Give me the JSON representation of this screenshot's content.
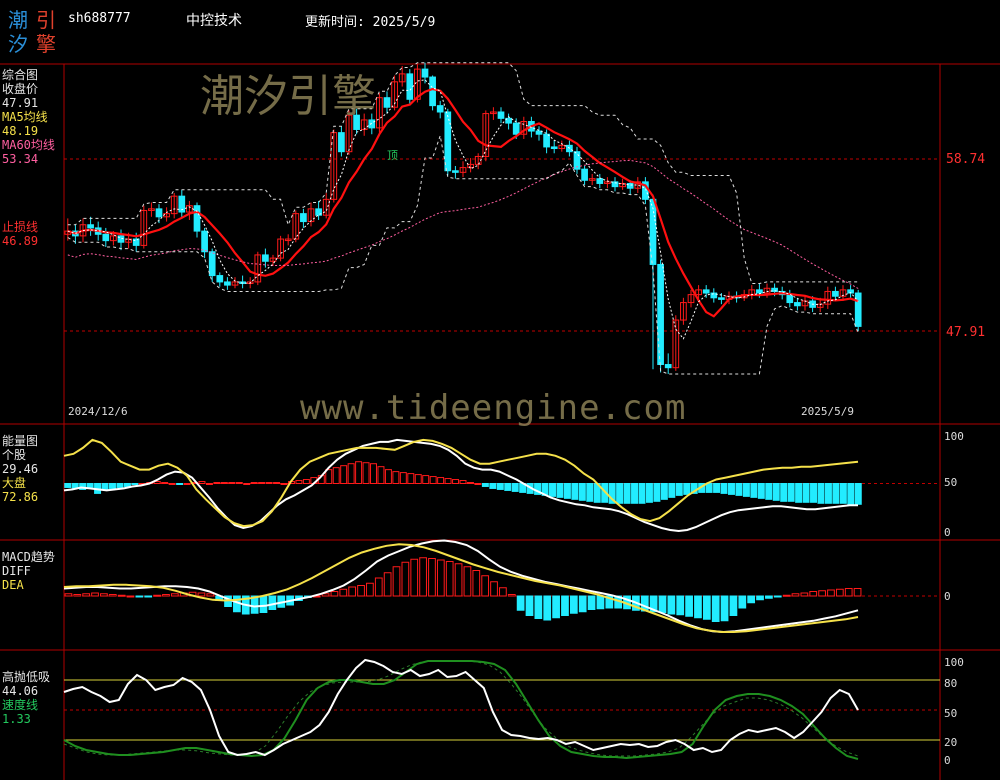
{
  "header": {
    "logo_chars": [
      "潮",
      "引",
      "汐",
      "擎"
    ],
    "symbol": "sh688777",
    "name": "中控技术",
    "update_label": "更新时间: 2025/5/9"
  },
  "watermarks": {
    "cn": "潮汐引擎",
    "url": "www.tideengine.com"
  },
  "colors": {
    "up": "#ff1a1a",
    "down": "#22ecff",
    "ma5": "#f5e14a",
    "ma60": "#ff5fa0",
    "stoploss": "#ff2a2a",
    "grid": "#b00000"
  },
  "panel_main": {
    "title": "综合图",
    "close_label": "收盘价",
    "close_value": "47.91",
    "ma5_label": "MA5均线",
    "ma5_value": "48.19",
    "ma60_label": "MA60均线",
    "ma60_value": "53.34",
    "stop_label": "止损线",
    "stop_value": "46.89",
    "price_levels": [
      "58.74",
      "47.91"
    ],
    "start_date": "2024/12/6",
    "end_date": "2025/5/9",
    "marker_text": "顶",
    "candles": [
      [
        54.0,
        54.2,
        55.0,
        53.6
      ],
      [
        54.2,
        53.9,
        54.6,
        53.4
      ],
      [
        53.9,
        54.6,
        55.0,
        53.5
      ],
      [
        54.6,
        54.4,
        55.1,
        53.9
      ],
      [
        54.4,
        54.0,
        54.8,
        53.6
      ],
      [
        54.0,
        53.6,
        54.4,
        53.2
      ],
      [
        53.6,
        53.9,
        54.2,
        53.3
      ],
      [
        53.9,
        53.5,
        54.3,
        53.0
      ],
      [
        53.5,
        53.7,
        54.1,
        53.1
      ],
      [
        53.7,
        53.3,
        54.1,
        52.9
      ],
      [
        53.3,
        55.5,
        55.8,
        53.1
      ],
      [
        55.5,
        55.6,
        56.0,
        55.1
      ],
      [
        55.6,
        55.1,
        55.9,
        54.7
      ],
      [
        55.1,
        55.3,
        55.7,
        54.8
      ],
      [
        55.3,
        56.4,
        56.6,
        55.0
      ],
      [
        56.4,
        55.4,
        56.8,
        55.0
      ],
      [
        55.4,
        55.8,
        56.1,
        54.9
      ],
      [
        55.8,
        54.2,
        56.0,
        53.8
      ],
      [
        54.2,
        52.9,
        54.4,
        52.5
      ],
      [
        52.9,
        51.4,
        53.1,
        51.0
      ],
      [
        51.4,
        51.0,
        51.6,
        50.7
      ],
      [
        51.0,
        50.8,
        51.3,
        50.5
      ],
      [
        50.8,
        51.0,
        51.3,
        50.6
      ],
      [
        51.0,
        50.9,
        51.4,
        50.6
      ],
      [
        50.9,
        51.0,
        51.3,
        50.6
      ],
      [
        51.0,
        52.7,
        52.9,
        50.8
      ],
      [
        52.7,
        52.3,
        53.1,
        51.9
      ],
      [
        52.3,
        52.5,
        52.7,
        52.0
      ],
      [
        52.5,
        53.7,
        53.9,
        52.3
      ],
      [
        53.7,
        53.7,
        54.0,
        53.3
      ],
      [
        53.7,
        55.3,
        55.5,
        53.5
      ],
      [
        55.3,
        54.8,
        55.6,
        54.4
      ],
      [
        54.8,
        55.6,
        56.0,
        54.5
      ],
      [
        55.6,
        55.2,
        56.1,
        54.9
      ],
      [
        55.2,
        56.2,
        56.6,
        55.0
      ],
      [
        56.2,
        60.4,
        60.6,
        56.0
      ],
      [
        60.4,
        59.2,
        60.8,
        58.9
      ],
      [
        59.2,
        61.5,
        61.8,
        59.0
      ],
      [
        61.5,
        60.6,
        61.9,
        60.3
      ],
      [
        60.6,
        61.2,
        61.6,
        60.2
      ],
      [
        61.2,
        60.7,
        61.6,
        60.3
      ],
      [
        60.7,
        62.6,
        62.9,
        60.4
      ],
      [
        62.6,
        62.0,
        63.0,
        61.6
      ],
      [
        62.0,
        63.6,
        64.0,
        61.8
      ],
      [
        63.6,
        64.1,
        64.6,
        63.3
      ],
      [
        64.1,
        62.5,
        64.4,
        62.2
      ],
      [
        62.5,
        64.4,
        64.7,
        62.3
      ],
      [
        64.4,
        63.9,
        64.8,
        63.5
      ],
      [
        63.9,
        62.1,
        64.0,
        61.8
      ],
      [
        62.1,
        61.7,
        62.4,
        61.3
      ],
      [
        61.7,
        58.0,
        61.9,
        57.7
      ],
      [
        58.0,
        57.9,
        58.3,
        57.5
      ],
      [
        57.9,
        58.2,
        58.6,
        57.6
      ],
      [
        58.2,
        58.4,
        58.8,
        57.9
      ],
      [
        58.4,
        58.9,
        59.1,
        58.1
      ],
      [
        58.9,
        61.6,
        61.8,
        58.6
      ],
      [
        61.6,
        61.7,
        62.0,
        61.2
      ],
      [
        61.7,
        61.3,
        62.0,
        61.0
      ],
      [
        61.3,
        61.0,
        61.6,
        60.6
      ],
      [
        61.0,
        60.3,
        61.3,
        60.0
      ],
      [
        60.3,
        61.1,
        61.4,
        60.0
      ],
      [
        61.1,
        60.5,
        61.4,
        60.1
      ],
      [
        60.5,
        60.3,
        60.8,
        59.9
      ],
      [
        60.3,
        59.5,
        60.6,
        59.1
      ],
      [
        59.5,
        59.4,
        59.9,
        59.1
      ],
      [
        59.4,
        59.6,
        59.9,
        59.2
      ],
      [
        59.6,
        59.2,
        59.9,
        58.9
      ],
      [
        59.2,
        58.1,
        59.5,
        57.8
      ],
      [
        58.1,
        57.4,
        58.3,
        57.1
      ],
      [
        57.4,
        57.5,
        57.8,
        57.1
      ],
      [
        57.5,
        57.2,
        57.8,
        56.9
      ],
      [
        57.2,
        57.3,
        57.6,
        56.9
      ],
      [
        57.3,
        57.0,
        57.6,
        56.7
      ],
      [
        57.0,
        57.2,
        57.5,
        56.8
      ],
      [
        57.2,
        56.9,
        57.4,
        56.5
      ],
      [
        56.9,
        57.3,
        57.6,
        56.6
      ],
      [
        57.3,
        56.2,
        57.6,
        55.9
      ],
      [
        56.2,
        52.1,
        56.5,
        45.5
      ],
      [
        52.1,
        45.8,
        52.4,
        45.3
      ],
      [
        45.8,
        45.6,
        46.5,
        45.2
      ],
      [
        45.6,
        48.6,
        48.9,
        45.4
      ],
      [
        48.6,
        49.7,
        50.0,
        48.3
      ],
      [
        49.7,
        50.2,
        50.5,
        49.4
      ],
      [
        50.2,
        50.5,
        50.8,
        49.9
      ],
      [
        50.5,
        50.3,
        50.8,
        50.0
      ],
      [
        50.3,
        50.0,
        50.6,
        49.7
      ],
      [
        50.0,
        49.9,
        50.3,
        49.6
      ],
      [
        49.9,
        50.1,
        50.4,
        49.6
      ],
      [
        50.1,
        50.0,
        50.4,
        49.7
      ],
      [
        50.0,
        50.2,
        50.5,
        49.8
      ],
      [
        50.2,
        50.5,
        50.8,
        49.9
      ],
      [
        50.5,
        50.3,
        50.9,
        50.0
      ],
      [
        50.3,
        50.6,
        50.9,
        50.0
      ],
      [
        50.6,
        50.4,
        50.9,
        50.1
      ],
      [
        50.4,
        50.2,
        50.7,
        49.9
      ],
      [
        50.2,
        49.7,
        50.5,
        49.4
      ],
      [
        49.7,
        49.5,
        50.0,
        49.2
      ],
      [
        49.5,
        49.8,
        50.1,
        49.2
      ],
      [
        49.8,
        49.4,
        50.1,
        49.1
      ],
      [
        49.4,
        49.6,
        50.0,
        49.1
      ],
      [
        49.6,
        50.4,
        50.7,
        49.3
      ],
      [
        50.4,
        50.1,
        50.7,
        49.8
      ],
      [
        50.1,
        50.5,
        50.8,
        49.8
      ],
      [
        50.5,
        50.3,
        50.8,
        50.0
      ],
      [
        50.3,
        48.2,
        50.5,
        47.9
      ]
    ]
  },
  "panel_energy": {
    "title": "能量图",
    "stock_label": "个股",
    "stock_value": "29.46",
    "market_label": "大盘",
    "market_value": "72.86",
    "scale": [
      "100",
      "50",
      "0"
    ],
    "bars": [
      -4,
      -5,
      -6,
      -4,
      -10,
      -6,
      -5,
      -4,
      -3,
      -1,
      0,
      1,
      2,
      1,
      0,
      -1,
      0,
      1,
      2,
      0,
      1,
      1,
      1,
      1,
      0,
      1,
      1,
      1,
      1,
      0,
      2,
      3,
      4,
      6,
      8,
      14,
      16,
      18,
      20,
      22,
      21,
      20,
      17,
      14,
      12,
      11,
      10,
      9,
      8,
      7,
      6,
      5,
      4,
      3,
      1,
      0,
      -3,
      -5,
      -6,
      -7,
      -8,
      -9,
      -10,
      -11,
      -12,
      -13,
      -14,
      -15,
      -16,
      -17,
      -18,
      -19,
      -19,
      -20,
      -20,
      -20,
      -20,
      -20,
      -19,
      -18,
      -16,
      -14,
      -12,
      -11,
      -10,
      -9,
      -9,
      -9,
      -10,
      -11,
      -12,
      -13,
      -14,
      -15,
      -16,
      -17,
      -18,
      -18,
      -19,
      -19,
      -19,
      -20,
      -20,
      -20,
      -20,
      -21,
      -21
    ],
    "stock_line": [
      43,
      44,
      46,
      45,
      44,
      43,
      44,
      45,
      47,
      48,
      50,
      54,
      59,
      62,
      61,
      56,
      46,
      36,
      25,
      16,
      8,
      5,
      7,
      12,
      20,
      28,
      34,
      38,
      43,
      48,
      56,
      66,
      74,
      80,
      84,
      88,
      90,
      92,
      92,
      94,
      93,
      92,
      91,
      90,
      88,
      84,
      78,
      70,
      66,
      64,
      64,
      62,
      58,
      54,
      49,
      44,
      40,
      36,
      33,
      31,
      29,
      28,
      26,
      25,
      24,
      22,
      19,
      15,
      11,
      8,
      5,
      3,
      2,
      3,
      6,
      10,
      14,
      18,
      21,
      23,
      24,
      25,
      26,
      27,
      27,
      26,
      25,
      24,
      24,
      25,
      26,
      27,
      28,
      28
    ],
    "market_line": [
      78,
      80,
      86,
      94,
      91,
      82,
      72,
      68,
      64,
      64,
      68,
      70,
      66,
      58,
      44,
      34,
      25,
      16,
      10,
      7,
      8,
      12,
      22,
      36,
      52,
      64,
      72,
      76,
      80,
      82,
      84,
      86,
      86,
      86,
      85,
      84,
      88,
      92,
      94,
      93,
      90,
      86,
      80,
      74,
      70,
      70,
      72,
      74,
      76,
      78,
      80,
      80,
      78,
      74,
      68,
      60,
      54,
      44,
      34,
      26,
      19,
      14,
      12,
      15,
      22,
      30,
      38,
      44,
      50,
      54,
      56,
      58,
      60,
      62,
      64,
      65,
      66,
      66,
      67,
      67,
      68,
      69,
      70,
      71,
      72
    ]
  },
  "panel_macd": {
    "title": "MACD趋势",
    "diff_label": "DIFF",
    "dea_label": "DEA",
    "scale": [
      "0"
    ],
    "bars": [
      0.3,
      0.2,
      0.3,
      0.4,
      0.3,
      0.2,
      0.1,
      0.0,
      -0.1,
      -0.1,
      0.1,
      0.2,
      0.3,
      0.4,
      0.5,
      0.4,
      0.3,
      -0.6,
      -1.4,
      -2.1,
      -2.4,
      -2.3,
      -2.2,
      -1.8,
      -1.5,
      -1.2,
      -0.6,
      -0.2,
      0.0,
      0.3,
      0.6,
      0.9,
      1.2,
      1.4,
      1.7,
      2.4,
      3.1,
      3.9,
      4.5,
      4.9,
      5.1,
      5.0,
      4.8,
      4.6,
      4.3,
      3.9,
      3.4,
      2.7,
      1.9,
      1.1,
      0.2,
      -1.9,
      -2.6,
      -3.0,
      -3.2,
      -2.9,
      -2.6,
      -2.3,
      -2.1,
      -1.8,
      -1.7,
      -1.6,
      -1.6,
      -1.7,
      -1.9,
      -2.0,
      -2.1,
      -2.2,
      -2.4,
      -2.5,
      -2.7,
      -2.9,
      -3.1,
      -3.4,
      -3.3,
      -2.6,
      -1.6,
      -0.9,
      -0.5,
      -0.3,
      -0.1,
      0.1,
      0.3,
      0.4,
      0.6,
      0.7,
      0.8,
      0.9,
      1.0,
      1.0
    ],
    "diff_line": [
      1.0,
      1.1,
      1.2,
      1.2,
      1.1,
      1.0,
      1.0,
      1.1,
      1.2,
      1.3,
      1.3,
      1.2,
      1.0,
      0.6,
      0.0,
      -0.6,
      -1.1,
      -1.4,
      -1.3,
      -1.0,
      -0.7,
      -0.4,
      -0.1,
      0.3,
      0.8,
      1.4,
      2.3,
      3.4,
      4.6,
      5.4,
      6.0,
      6.6,
      7.0,
      7.3,
      7.4,
      7.2,
      6.8,
      6.0,
      4.9,
      3.9,
      3.2,
      2.7,
      2.3,
      1.9,
      1.6,
      1.3,
      1.0,
      0.7,
      0.4,
      0.1,
      -0.3,
      -0.8,
      -1.4,
      -2.0,
      -2.6,
      -3.3,
      -3.9,
      -4.4,
      -4.7,
      -4.8,
      -4.7,
      -4.5,
      -4.3,
      -4.1,
      -3.9,
      -3.7,
      -3.5,
      -3.3,
      -3.0,
      -2.7,
      -2.3,
      -1.9
    ],
    "dea_line": [
      1.2,
      1.3,
      1.3,
      1.4,
      1.5,
      1.5,
      1.4,
      1.3,
      1.1,
      0.7,
      0.2,
      -0.2,
      -0.5,
      -0.6,
      -0.5,
      -0.3,
      0.0,
      0.4,
      0.9,
      1.6,
      2.4,
      3.3,
      4.2,
      5.1,
      5.8,
      6.3,
      6.7,
      6.9,
      6.8,
      6.5,
      6.0,
      5.4,
      4.8,
      4.2,
      3.7,
      3.2,
      2.8,
      2.4,
      2.0,
      1.7,
      1.4,
      1.0,
      0.6,
      0.2,
      -0.3,
      -0.8,
      -1.4,
      -2.0,
      -2.6,
      -3.2,
      -3.8,
      -4.3,
      -4.6,
      -4.8,
      -4.8,
      -4.7,
      -4.5,
      -4.3,
      -4.1,
      -3.9,
      -3.7,
      -3.5,
      -3.3,
      -3.1,
      -2.8
    ]
  },
  "panel_kdj": {
    "title": "高抛低吸",
    "value": "44.06",
    "speed_label": "速度线",
    "speed_value": "1.33",
    "scale": [
      "100",
      "80",
      "50",
      "20",
      "0"
    ],
    "white_line": [
      68,
      71,
      73,
      68,
      64,
      58,
      60,
      76,
      85,
      80,
      70,
      73,
      75,
      82,
      78,
      70,
      50,
      24,
      8,
      5,
      6,
      8,
      5,
      10,
      16,
      20,
      24,
      28,
      35,
      48,
      66,
      80,
      92,
      100,
      98,
      94,
      88,
      86,
      90,
      84,
      86,
      90,
      83,
      84,
      88,
      80,
      72,
      48,
      30,
      25,
      24,
      22,
      21,
      22,
      20,
      16,
      18,
      14,
      10,
      12,
      14,
      16,
      15,
      16,
      13,
      14,
      18,
      20,
      16,
      10,
      12,
      8,
      10,
      20,
      26,
      30,
      28,
      30,
      32,
      28,
      22,
      28,
      38,
      48,
      62,
      70,
      66,
      50
    ],
    "green_line": [
      20,
      14,
      10,
      8,
      6,
      5,
      5,
      6,
      7,
      8,
      10,
      12,
      12,
      10,
      8,
      6,
      5,
      4,
      5,
      10,
      22,
      40,
      60,
      72,
      78,
      80,
      80,
      78,
      76,
      76,
      80,
      88,
      96,
      99,
      99,
      99,
      99,
      99,
      98,
      96,
      90,
      76,
      58,
      40,
      24,
      14,
      8,
      6,
      4,
      3,
      3,
      2,
      3,
      4,
      5,
      6,
      8,
      16,
      34,
      50,
      60,
      64,
      66,
      66,
      64,
      60,
      54,
      46,
      34,
      22,
      12,
      4,
      1
    ],
    "green_dash": [
      16,
      12,
      8,
      6,
      5,
      5,
      6,
      7,
      8,
      9,
      10,
      10,
      9,
      7,
      6,
      5,
      5,
      7,
      14,
      28,
      44,
      58,
      68,
      74,
      77,
      78,
      78,
      78,
      80,
      84,
      90,
      95,
      98,
      99,
      99,
      99,
      99,
      98,
      95,
      88,
      76,
      62,
      46,
      32,
      22,
      14,
      10,
      7,
      5,
      4,
      4,
      4,
      5,
      6,
      8,
      12,
      22,
      34,
      46,
      54,
      58,
      62,
      62,
      60,
      56,
      50,
      42,
      32,
      22,
      14,
      8,
      4
    ]
  }
}
